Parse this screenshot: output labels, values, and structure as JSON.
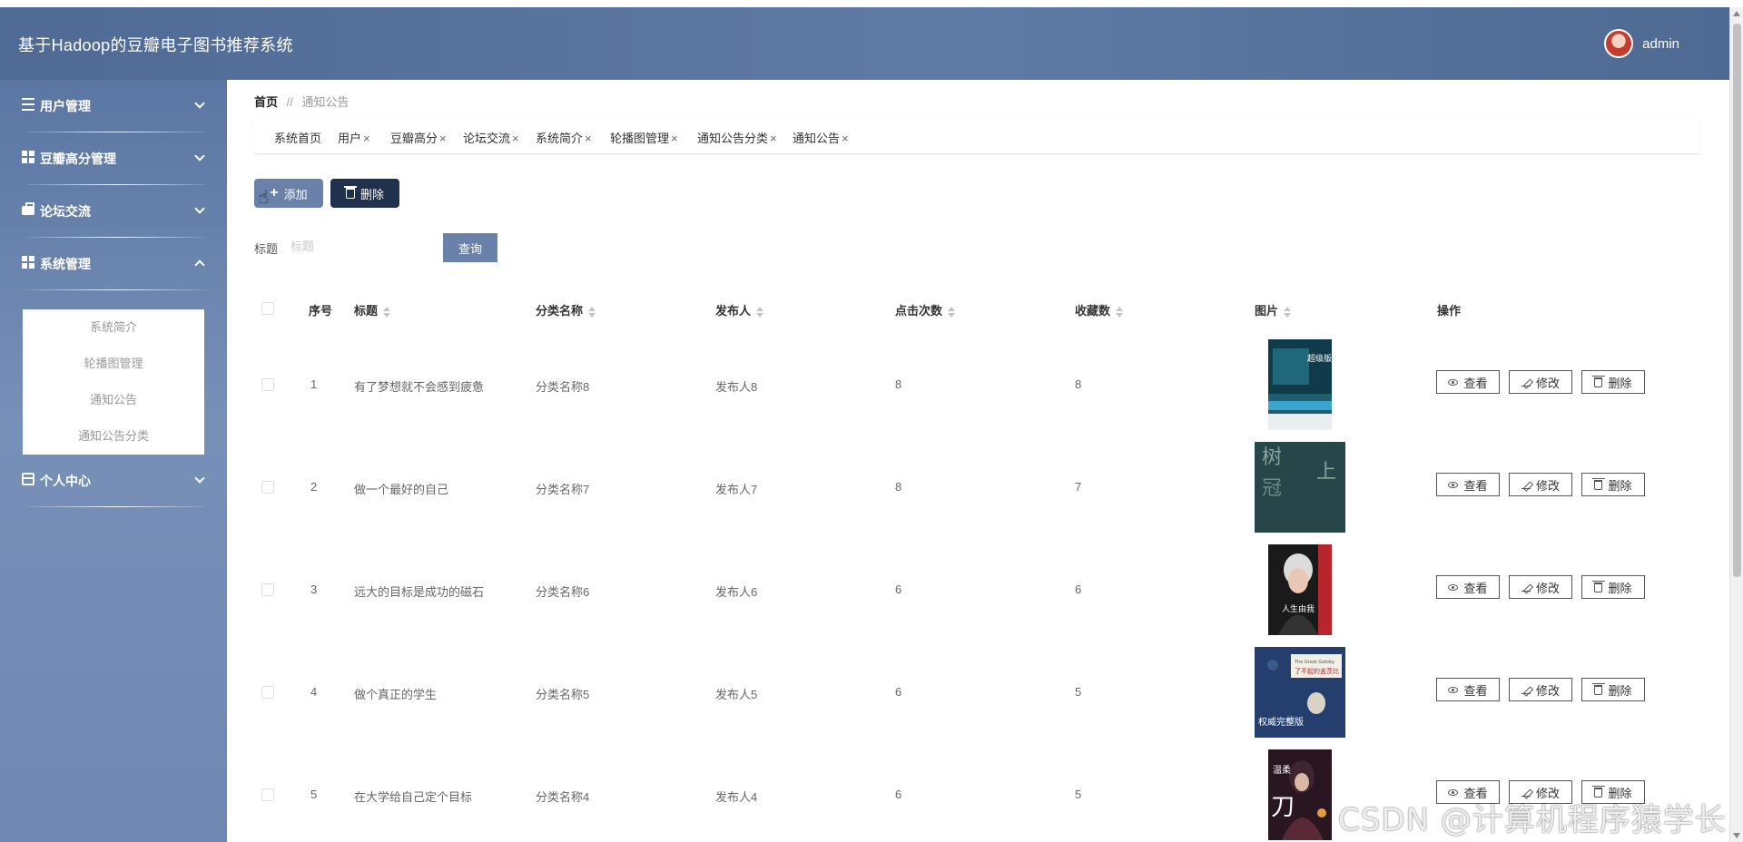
{
  "header": {
    "title": "基于Hadoop的豆瓣电子图书推荐系统",
    "username": "admin"
  },
  "sidebar": {
    "items": [
      {
        "label": "用户管理",
        "icon": "sliders-icon",
        "expanded": false
      },
      {
        "label": "豆瓣高分管理",
        "icon": "grid-icon",
        "expanded": false
      },
      {
        "label": "论坛交流",
        "icon": "briefcase-icon",
        "expanded": false
      },
      {
        "label": "系统管理",
        "icon": "grid-icon",
        "expanded": true
      },
      {
        "label": "个人中心",
        "icon": "card-icon",
        "expanded": false
      }
    ],
    "submenu": [
      "系统简介",
      "轮播图管理",
      "通知公告",
      "通知公告分类"
    ]
  },
  "breadcrumb": {
    "home": "首页",
    "separator": "//",
    "current": "通知公告"
  },
  "tabs": [
    {
      "label": "系统首页",
      "closable": false
    },
    {
      "label": "用户",
      "closable": true
    },
    {
      "label": "豆瓣高分",
      "closable": true
    },
    {
      "label": "论坛交流",
      "closable": true
    },
    {
      "label": "系统简介",
      "closable": true
    },
    {
      "label": "轮播图管理",
      "closable": true
    },
    {
      "label": "通知公告分类",
      "closable": true
    },
    {
      "label": "通知公告",
      "closable": true
    }
  ],
  "tab_close_glyph": "×",
  "toolbar": {
    "add_label": "添加",
    "delete_label": "删除",
    "add_glyph": "+"
  },
  "search": {
    "label": "标题",
    "placeholder": "标题",
    "button_label": "查询"
  },
  "table": {
    "headers": {
      "index": "序号",
      "title": "标题",
      "category": "分类名称",
      "publisher": "发布人",
      "clicks": "点击次数",
      "favorites": "收藏数",
      "image": "图片",
      "actions": "操作"
    },
    "rows": [
      {
        "index": "1",
        "title": "有了梦想就不会感到疲惫",
        "category": "分类名称8",
        "publisher": "发布人8",
        "clicks": "8",
        "favorites": "8",
        "cover": "book-cover-1"
      },
      {
        "index": "2",
        "title": "做一个最好的自己",
        "category": "分类名称7",
        "publisher": "发布人7",
        "clicks": "8",
        "favorites": "7",
        "cover": "book-cover-2"
      },
      {
        "index": "3",
        "title": "远大的目标是成功的磁石",
        "category": "分类名称6",
        "publisher": "发布人6",
        "clicks": "6",
        "favorites": "6",
        "cover": "book-cover-3"
      },
      {
        "index": "4",
        "title": "做个真正的学生",
        "category": "分类名称5",
        "publisher": "发布人5",
        "clicks": "6",
        "favorites": "5",
        "cover": "book-cover-4"
      },
      {
        "index": "5",
        "title": "在大学给自己定个目标",
        "category": "分类名称4",
        "publisher": "发布人4",
        "clicks": "6",
        "favorites": "5",
        "cover": "book-cover-5"
      }
    ],
    "actions": {
      "view": "查看",
      "edit": "修改",
      "delete": "删除"
    }
  },
  "covers": {
    "c1": {
      "title": "超级版图"
    },
    "c2": {
      "title_a": "树",
      "title_b": "上",
      "title_c": "冠"
    },
    "c3": {
      "title": "人生由我"
    },
    "c4": {
      "title_en": "The Great Gatsby",
      "title": "了不起的盖茨比",
      "edition": "权威完整版"
    },
    "c5": {
      "title": "温柔",
      "title_b": "刀"
    }
  },
  "watermark": "CSDN @计算机程序猿学长",
  "colors": {
    "header": "#5f7aa4",
    "sidebar": "#6f88b2",
    "primary_button": "#6a82a9",
    "danger_button": "#20304d"
  }
}
